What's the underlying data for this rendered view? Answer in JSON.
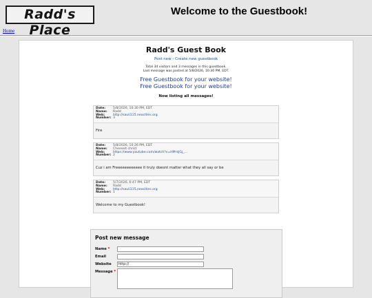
{
  "site": {
    "logo_text": "Radd's Place",
    "title": "Welcome to the Guestbook!",
    "home_link": "Home"
  },
  "guestbook": {
    "title": "Radd's Guest Book",
    "links": {
      "post_new": "Post new",
      "separator": "-",
      "create_new": "Create new guestbook"
    },
    "stats_line1": "Total 34 visitors and 3 messages in this guestbook.",
    "stats_line2": "Last message was posted at 5/8/2026, 10:30 PM, EDT.",
    "promo_1": "Free Guestbook for your website!",
    "promo_2": "Free Guestbook for your website!",
    "listing_label": "Now listing all messages!"
  },
  "labels": {
    "date": "Date:",
    "name": "Name:",
    "web": "Web:",
    "number": "Number:"
  },
  "messages": [
    {
      "date": "5/8/2026, 10:30 PM, EDT",
      "name": "Radd",
      "web": "http://sauli115.neocities.org",
      "number": "3",
      "body": "Fire"
    },
    {
      "date": "5/8/2026, 10:26 PM, EDT",
      "name": "Cheeseit christ",
      "web": "https://www.youtube.com/watch?v=HM-kJGj_...",
      "number": "2",
      "body": "Cuz i am Freeeeeeeeeeee it truly doesnt matter what they all say or be"
    },
    {
      "date": "5/7/2026, 6:47 PM, EDT",
      "name": "Radd",
      "web": "http://sauli115.neocities.org",
      "number": "1",
      "body": "Welcome to my Guestbook!"
    }
  ],
  "form": {
    "title": "Post new message",
    "name_label": "Name",
    "email_label": "Email",
    "website_label": "Website",
    "message_label": "Message",
    "required_mark": "*",
    "name_value": "",
    "email_value": "",
    "website_value": "http://"
  }
}
